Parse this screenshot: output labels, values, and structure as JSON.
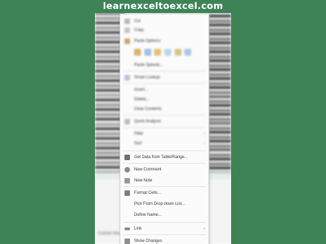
{
  "watermark": "learnexceltoexcel.com",
  "menu": {
    "blurred_items": [
      {
        "label": "Cut"
      },
      {
        "label": "Copy"
      },
      {
        "label": "Paste Options:"
      },
      {
        "label": "Paste Special..."
      },
      {
        "label": "Smart Lookup"
      },
      {
        "label": "Insert..."
      },
      {
        "label": "Delete..."
      },
      {
        "label": "Clear Contents"
      },
      {
        "label": "Quick Analysis"
      },
      {
        "label": "Filter"
      },
      {
        "label": "Sort"
      }
    ],
    "items": [
      {
        "label": "Get Data from Table/Range...",
        "icon": "table-icon"
      },
      {
        "label": "New Comment",
        "icon": "comment-icon"
      },
      {
        "label": "New Note",
        "icon": "note-icon"
      },
      {
        "label": "Format Cells...",
        "icon": "format-cells-icon"
      },
      {
        "label": "Pick From Drop-down List...",
        "icon": ""
      },
      {
        "label": "Define Name...",
        "icon": ""
      },
      {
        "label": "Link",
        "icon": "link-icon"
      },
      {
        "label": "Show Changes",
        "icon": "changes-icon"
      }
    ]
  },
  "sheet": {
    "bottom_label": "Custom Num"
  }
}
